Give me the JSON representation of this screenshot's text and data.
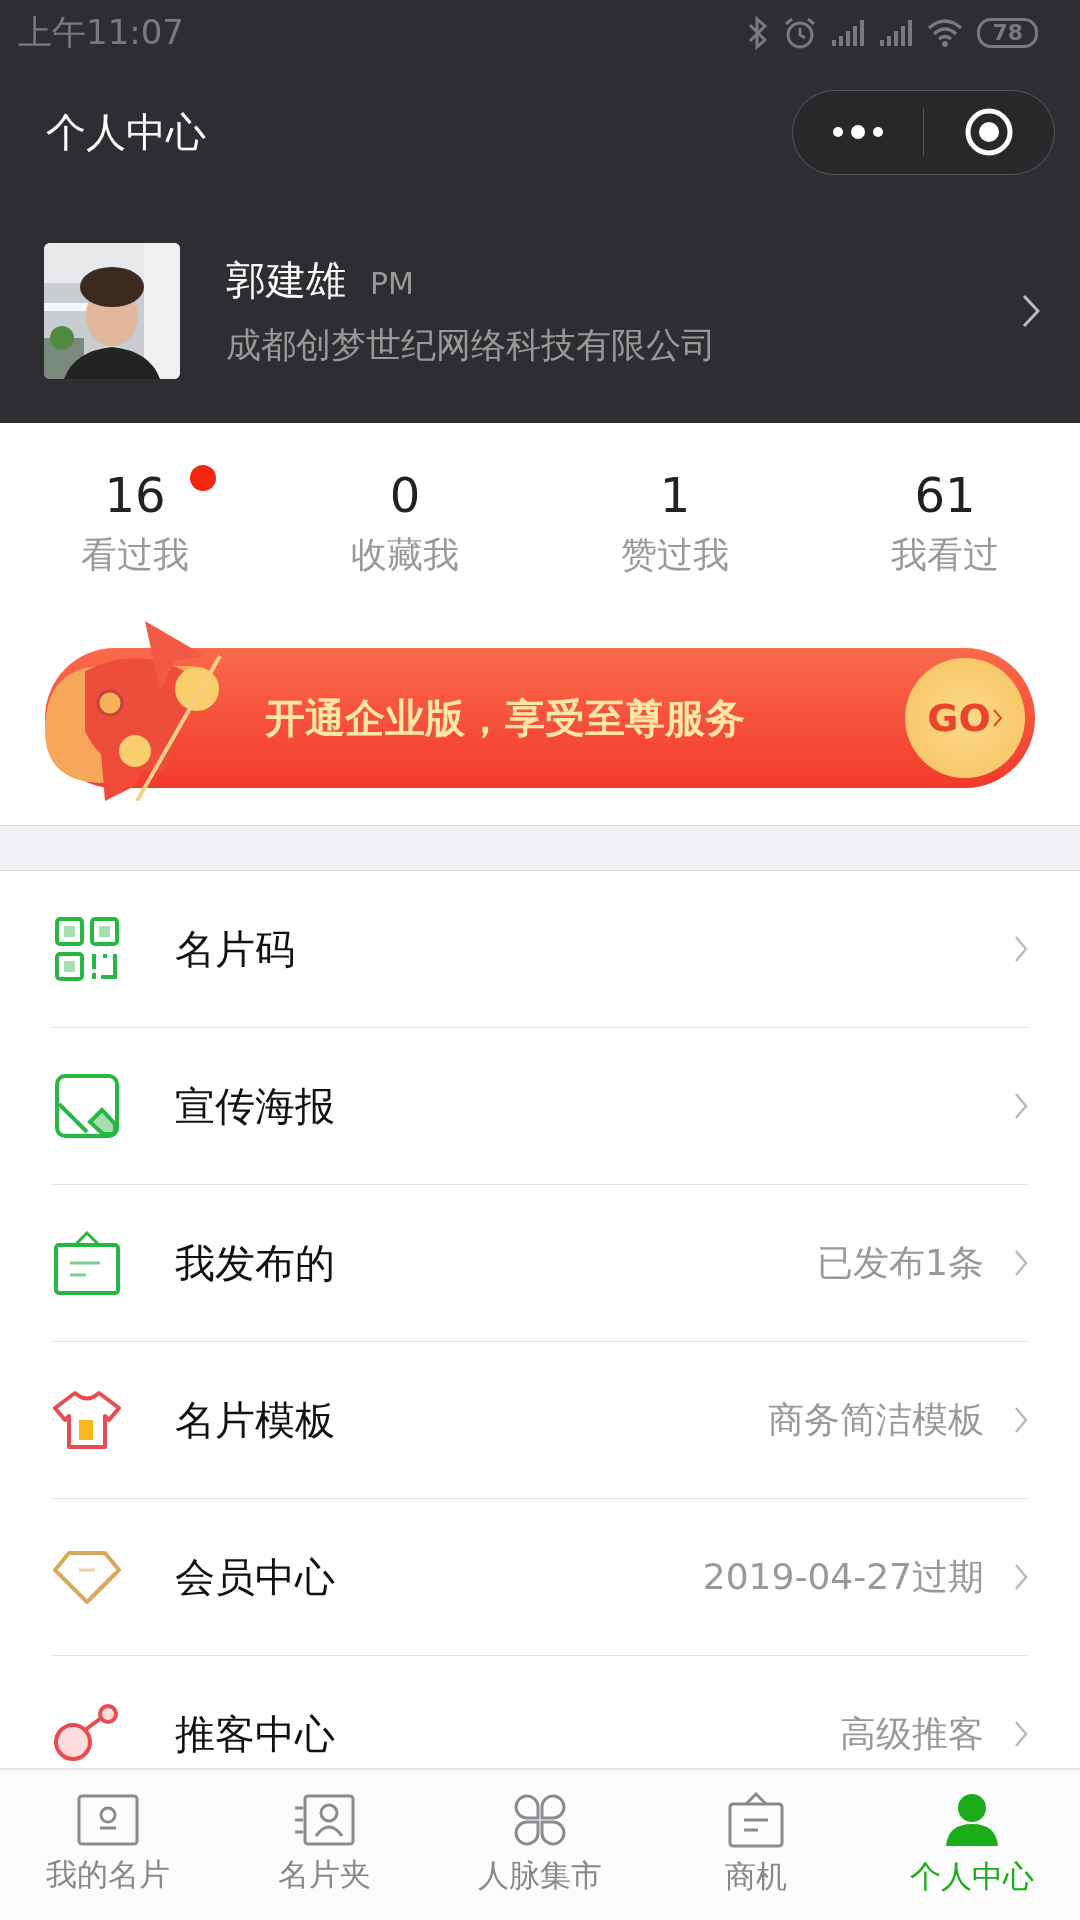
{
  "status_bar": {
    "time": "上午11:07",
    "battery": "78"
  },
  "header": {
    "title": "个人中心"
  },
  "profile": {
    "name": "郭建雄",
    "role": "PM",
    "company": "成都创梦世纪网络科技有限公司"
  },
  "stats": [
    {
      "count": "16",
      "label": "看过我",
      "unread": true
    },
    {
      "count": "0",
      "label": "收藏我",
      "unread": false
    },
    {
      "count": "1",
      "label": "赞过我",
      "unread": false
    },
    {
      "count": "61",
      "label": "我看过",
      "unread": false
    }
  ],
  "banner": {
    "text": "开通企业版，享受至尊服务",
    "button": "GO"
  },
  "menu": [
    {
      "kind": "qr",
      "label": "名片码"
    },
    {
      "kind": "poster",
      "label": "宣传海报"
    },
    {
      "kind": "publish",
      "label": "我发布的",
      "value": "已发布1条"
    },
    {
      "kind": "template",
      "label": "名片模板",
      "value": "商务简洁模板"
    },
    {
      "kind": "vip",
      "label": "会员中心",
      "value": "2019-04-27过期"
    },
    {
      "kind": "referral",
      "label": "推客中心",
      "value": "高级推客"
    }
  ],
  "tabs": [
    {
      "kind": "card",
      "label": "我的名片",
      "selected": false
    },
    {
      "kind": "contacts",
      "label": "名片夹",
      "selected": false
    },
    {
      "kind": "market",
      "label": "人脉集市",
      "selected": false
    },
    {
      "kind": "business",
      "label": "商机",
      "selected": false
    },
    {
      "kind": "profile",
      "label": "个人中心",
      "selected": true
    }
  ]
}
